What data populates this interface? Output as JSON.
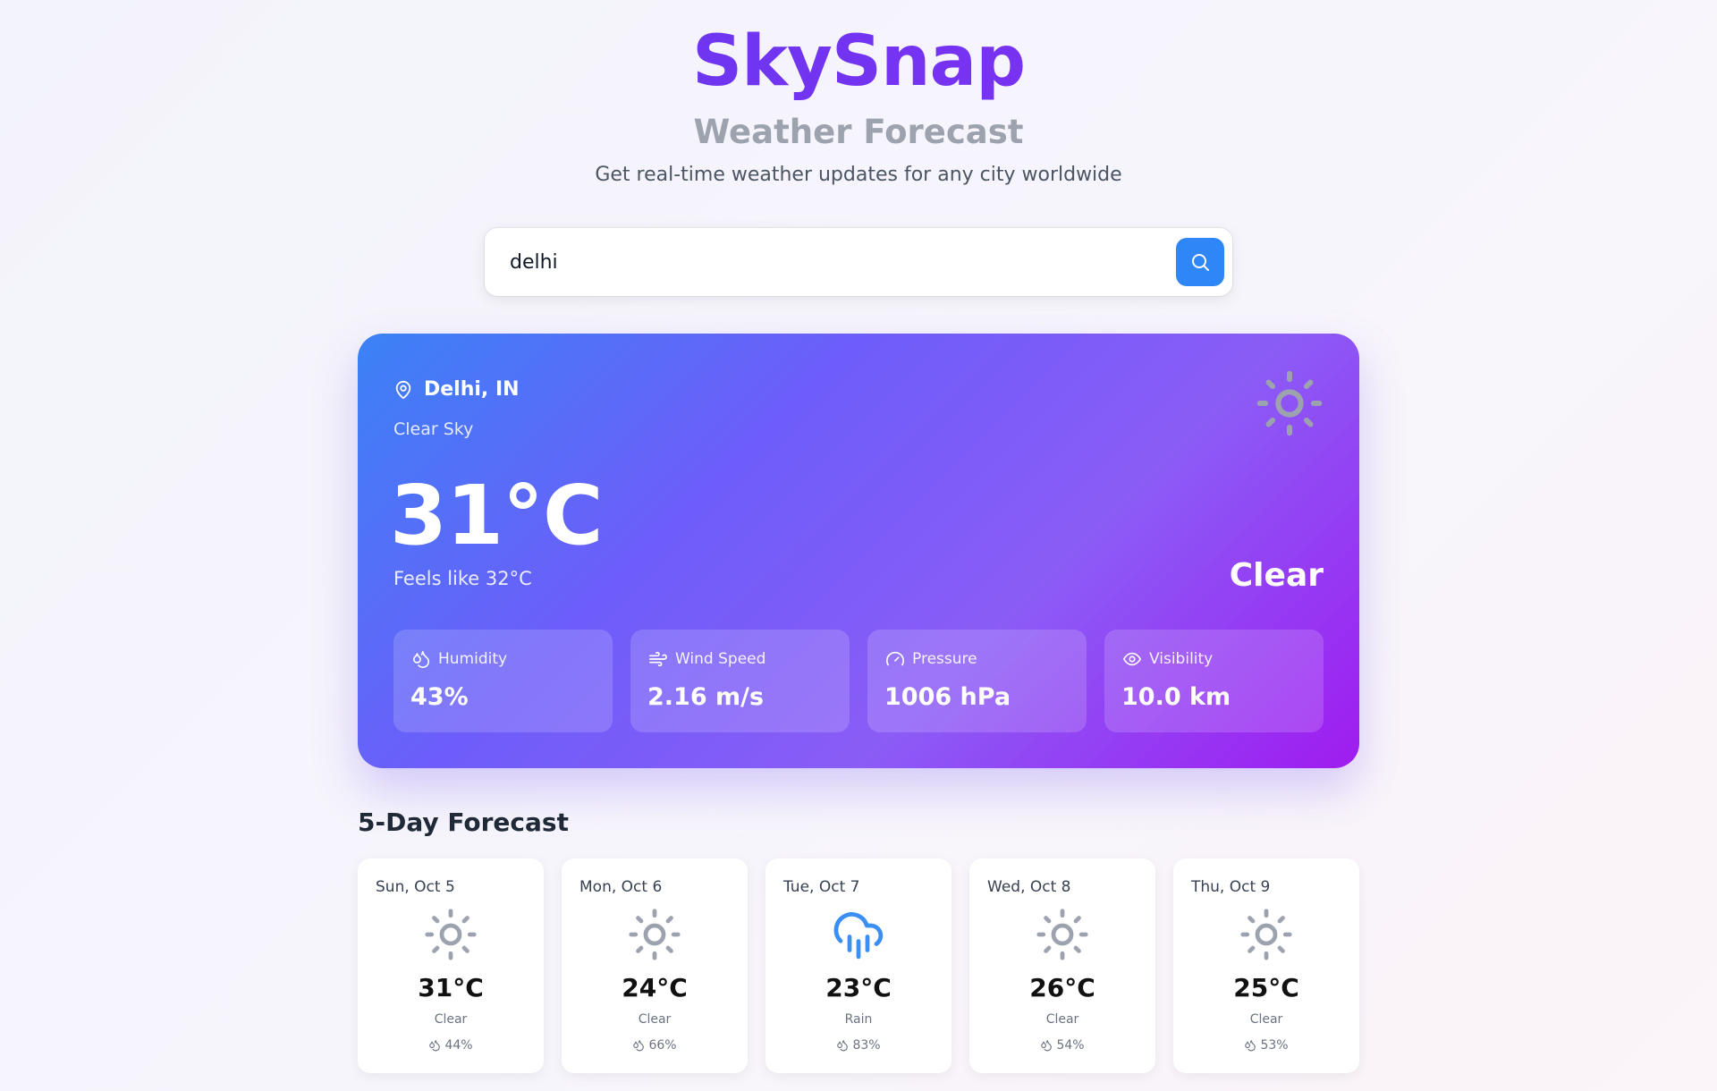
{
  "header": {
    "brand": "SkySnap",
    "subtitle": "Weather Forecast",
    "tagline": "Get real-time weather updates for any city worldwide"
  },
  "search": {
    "value": "delhi",
    "icon": "search-icon"
  },
  "current": {
    "location": "Delhi, IN",
    "description": "Clear Sky",
    "temperature": "31°C",
    "feels_like": "Feels like 32°C",
    "condition": "Clear",
    "icon": "sun-icon",
    "stats": [
      {
        "label": "Humidity",
        "value": "43%",
        "icon": "droplets-icon"
      },
      {
        "label": "Wind Speed",
        "value": "2.16 m/s",
        "icon": "wind-icon"
      },
      {
        "label": "Pressure",
        "value": "1006 hPa",
        "icon": "gauge-icon"
      },
      {
        "label": "Visibility",
        "value": "10.0 km",
        "icon": "eye-icon"
      }
    ]
  },
  "forecast": {
    "title": "5-Day Forecast",
    "days": [
      {
        "date": "Sun, Oct 5",
        "temp": "31°C",
        "condition": "Clear",
        "humidity": "44%",
        "icon": "sun-icon"
      },
      {
        "date": "Mon, Oct 6",
        "temp": "24°C",
        "condition": "Clear",
        "humidity": "66%",
        "icon": "sun-icon"
      },
      {
        "date": "Tue, Oct 7",
        "temp": "23°C",
        "condition": "Rain",
        "humidity": "83%",
        "icon": "cloud-rain-icon"
      },
      {
        "date": "Wed, Oct 8",
        "temp": "26°C",
        "condition": "Clear",
        "humidity": "54%",
        "icon": "sun-icon"
      },
      {
        "date": "Thu, Oct 9",
        "temp": "25°C",
        "condition": "Clear",
        "humidity": "53%",
        "icon": "sun-icon"
      }
    ]
  },
  "colors": {
    "brand_start": "#5b3cf0",
    "brand_end": "#8b2cf2",
    "search_button": "#2f86f6",
    "card_start": "#3b82f6",
    "card_end": "#9f1cf0",
    "sun_icon": "#9ca3af",
    "rain_icon": "#3b8ef2"
  }
}
